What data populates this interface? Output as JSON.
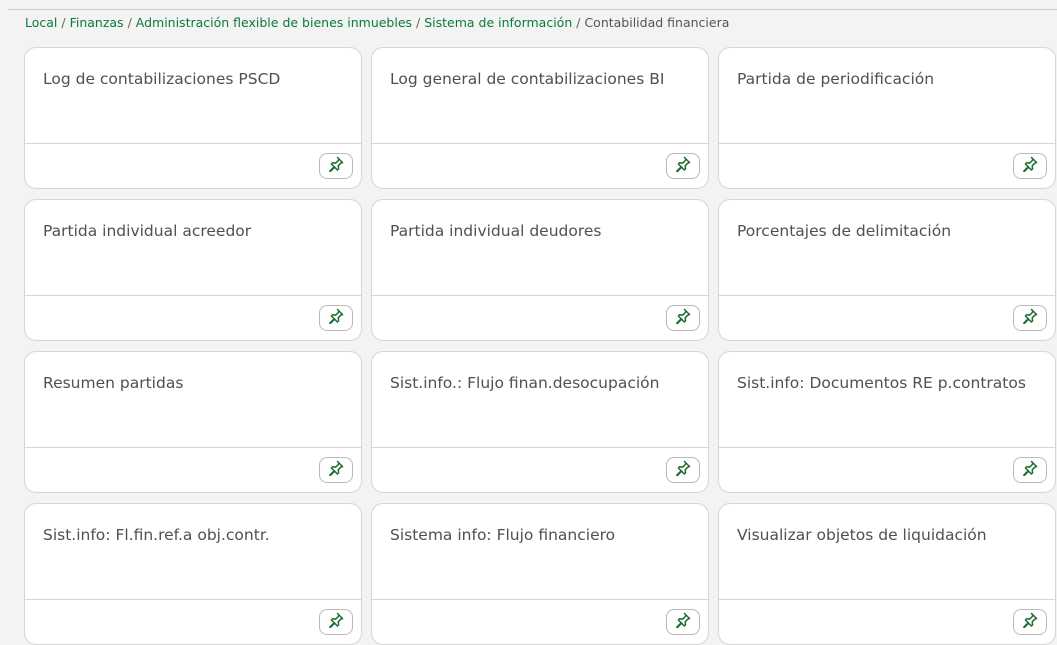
{
  "breadcrumb": {
    "items": [
      "Local",
      "Finanzas",
      "Administración flexible de bienes inmuebles",
      "Sistema de información"
    ],
    "current": "Contabilidad financiera",
    "separator": "/"
  },
  "cards": [
    {
      "title": "Log de contabilizaciones PSCD",
      "icon": "pin-icon"
    },
    {
      "title": "Log general de contabilizaciones BI",
      "icon": "pin-icon"
    },
    {
      "title": "Partida de periodificación",
      "icon": "pin-icon"
    },
    {
      "title": "Partida individual acreedor",
      "icon": "pin-icon"
    },
    {
      "title": "Partida individual deudores",
      "icon": "pin-icon"
    },
    {
      "title": "Porcentajes de delimitación",
      "icon": "pin-icon"
    },
    {
      "title": "Resumen partidas",
      "icon": "pin-icon"
    },
    {
      "title": "Sist.info.: Flujo finan.desocupación",
      "icon": "pin-icon"
    },
    {
      "title": "Sist.info: Documentos RE p.contratos",
      "icon": "pin-icon"
    },
    {
      "title": "Sist.info: Fl.fin.ref.a obj.contr.",
      "icon": "pin-icon"
    },
    {
      "title": "Sistema info: Flujo financiero",
      "icon": "pin-icon"
    },
    {
      "title": "Visualizar objetos de liquidación",
      "icon": "pin-icon"
    }
  ],
  "colors": {
    "link": "#0a7a3c",
    "pin": "#1c6b2f",
    "background": "#f3f3f3",
    "card": "#ffffff"
  }
}
